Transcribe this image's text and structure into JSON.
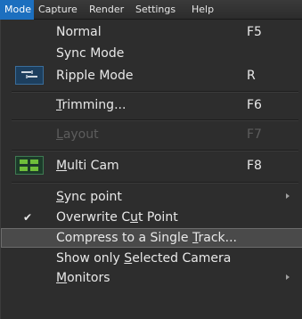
{
  "menubar": {
    "items": [
      {
        "label": "Mode"
      },
      {
        "label": "Capture"
      },
      {
        "label": "Render"
      },
      {
        "label": "Settings"
      },
      {
        "label": "Help"
      }
    ]
  },
  "menu": {
    "items": [
      {
        "label": "Normal",
        "shortcut": "F5"
      },
      {
        "label": "Sync Mode",
        "shortcut": ""
      },
      {
        "label": "Ripple Mode",
        "shortcut": "R",
        "icon": "ripple-mode-icon"
      },
      {
        "label_pre": "",
        "label_u": "T",
        "label_post": "rimming...",
        "shortcut": "F6"
      },
      {
        "label_pre": "",
        "label_u": "L",
        "label_post": "ayout",
        "shortcut": "F7",
        "disabled": true
      },
      {
        "label_pre": "",
        "label_u": "M",
        "label_post": "ulti Cam",
        "shortcut": "F8",
        "icon": "multi-cam-icon"
      },
      {
        "label_pre": "",
        "label_u": "S",
        "label_post": "ync point",
        "submenu": true
      },
      {
        "label_pre": "Overwrite C",
        "label_u": "u",
        "label_post": "t Point",
        "checked": true,
        "check_glyph": "✔"
      },
      {
        "label_pre": "Compress to a Single ",
        "label_u": "T",
        "label_post": "rack...",
        "highlighted": true
      },
      {
        "label_pre": "Show only ",
        "label_u": "S",
        "label_post": "elected Camera"
      },
      {
        "label_pre": "",
        "label_u": "M",
        "label_post": "onitors",
        "submenu": true
      }
    ]
  },
  "colors": {
    "active_menu": "#1c6fbf",
    "menu_bg": "#2d2d2d",
    "highlight_bg": "#4a4a4a",
    "disabled_text": "#5d5d5d"
  }
}
